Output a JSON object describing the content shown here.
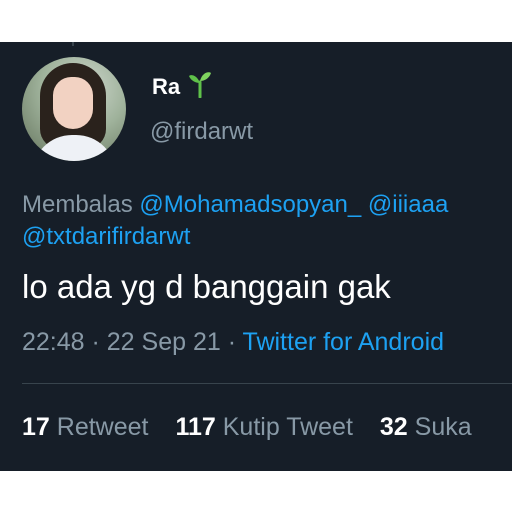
{
  "tweet": {
    "user": {
      "name": "Ra",
      "handle": "@firdarwt"
    },
    "reply": {
      "prefix": "Membalas",
      "mention_1": "@Mohamadsopyan_",
      "mention_2": "@iiiaaa",
      "mention_3": "@txtdarifirdarwt"
    },
    "text": "lo ada yg d banggain gak",
    "meta": {
      "time": "22:48",
      "separator_1": " · ",
      "date": "22 Sep 21",
      "separator_2": " · ",
      "source": "Twitter for Android"
    },
    "stats": {
      "retweets": "17",
      "retweets_label": "Retweet",
      "quotes": "117",
      "quotes_label": "Kutip Tweet",
      "likes": "32",
      "likes_label": "Suka"
    }
  },
  "colors": {
    "background": "#161e28",
    "accent": "#1da1f2",
    "secondary_text": "#8899a6",
    "primary_text": "#ffffff"
  },
  "icons": {
    "name_badge": "seedling-icon"
  }
}
